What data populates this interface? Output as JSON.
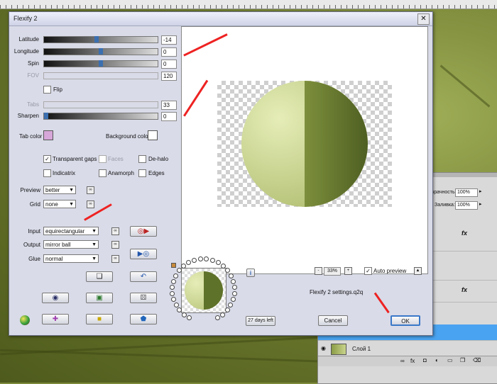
{
  "dialog": {
    "title": "Flexify 2",
    "sliders": [
      {
        "label": "Latitude",
        "value": "-14",
        "level": 0.46,
        "enabled": true
      },
      {
        "label": "Longitude",
        "value": "0",
        "level": 0.5,
        "enabled": true
      },
      {
        "label": "Spin",
        "value": "0",
        "level": 0.5,
        "enabled": true
      },
      {
        "label": "FOV",
        "value": "120",
        "level": 0,
        "enabled": false
      }
    ],
    "flip_label": "Flip",
    "tabs_slider": {
      "label": "Tabs",
      "value": "33",
      "enabled": false
    },
    "sharpen_slider": {
      "label": "Sharpen",
      "value": "0",
      "level": 0,
      "enabled": true
    },
    "tab_color_label": "Tab color",
    "tab_color": "#d7a7d9",
    "background_color_label": "Background color",
    "background_color": "#ffffff",
    "checkboxes": [
      {
        "label": "Transparent gaps",
        "checked": true,
        "enabled": true
      },
      {
        "label": "Faces",
        "checked": false,
        "enabled": false
      },
      {
        "label": "De-halo",
        "checked": false,
        "enabled": true
      },
      {
        "label": "Indicatrix",
        "checked": false,
        "enabled": true
      },
      {
        "label": "Anamorph",
        "checked": false,
        "enabled": true
      },
      {
        "label": "Edges",
        "checked": false,
        "enabled": true
      }
    ],
    "preview": {
      "label": "Preview",
      "value": "better"
    },
    "grid": {
      "label": "Grid",
      "value": "none"
    },
    "input": {
      "label": "Input",
      "value": "equirectangular"
    },
    "output": {
      "label": "Output",
      "value": "mirror ball"
    },
    "glue": {
      "label": "Glue",
      "value": "normal"
    },
    "zoom": "33%",
    "zoom_minus": "-",
    "zoom_plus": "+",
    "auto_preview_label": "Auto preview",
    "auto_preview_checked": true,
    "settings_file": "Flexify 2 settings.q2q",
    "days_left": "27 days left",
    "cancel_label": "Cancel",
    "ok_label": "OK",
    "info_label": "i"
  },
  "layers_panel": {
    "opacity_label": "зрачность:",
    "opacity_value": "100%",
    "fill_label": "Заливка:",
    "fill_value": "100%",
    "fx_label": "fx",
    "layer_name": "Слой 1"
  },
  "colors": {
    "dialog_bg": "#d9dbe8",
    "sphere_light": "#d9e3a4",
    "sphere_dark": "#5b6e2a",
    "arrow_red": "#e22222",
    "selection_blue": "#4aa3f0"
  }
}
